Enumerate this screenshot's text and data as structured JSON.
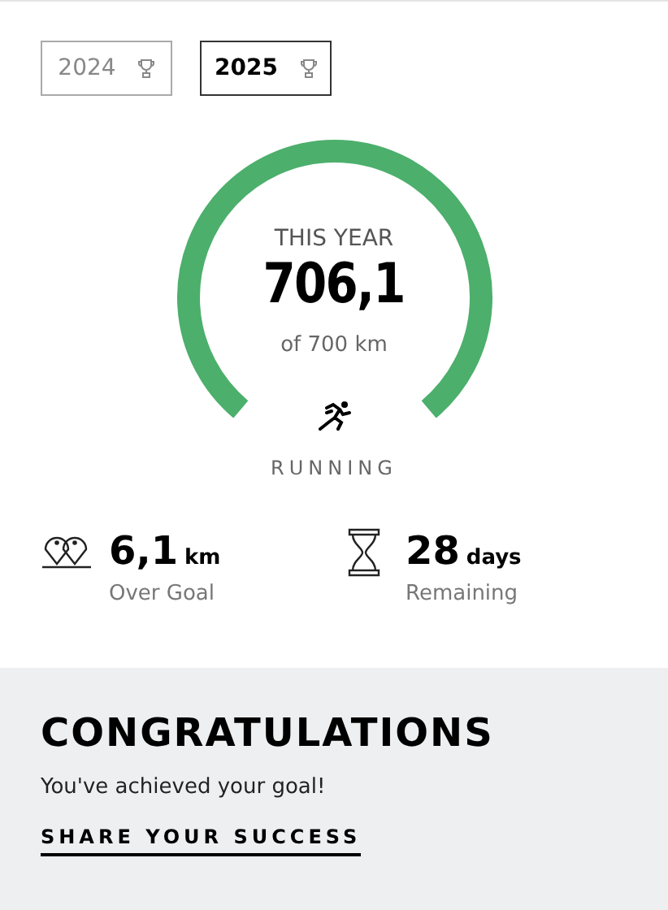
{
  "years": [
    {
      "label": "2024",
      "selected": false
    },
    {
      "label": "2025",
      "selected": true
    }
  ],
  "progress": {
    "caption": "THIS YEAR",
    "value": "706,1",
    "goal": "of 700 km",
    "sport": "RUNNING"
  },
  "stats": [
    {
      "kind": "distance",
      "value": "6,1",
      "unit": "km",
      "label": "Over Goal"
    },
    {
      "kind": "time",
      "value": "28",
      "unit": "days",
      "label": "Remaining"
    }
  ],
  "congrats": {
    "title": "CONGRATULATIONS",
    "message": "You've achieved your goal!",
    "link": "SHARE YOUR SUCCESS"
  }
}
